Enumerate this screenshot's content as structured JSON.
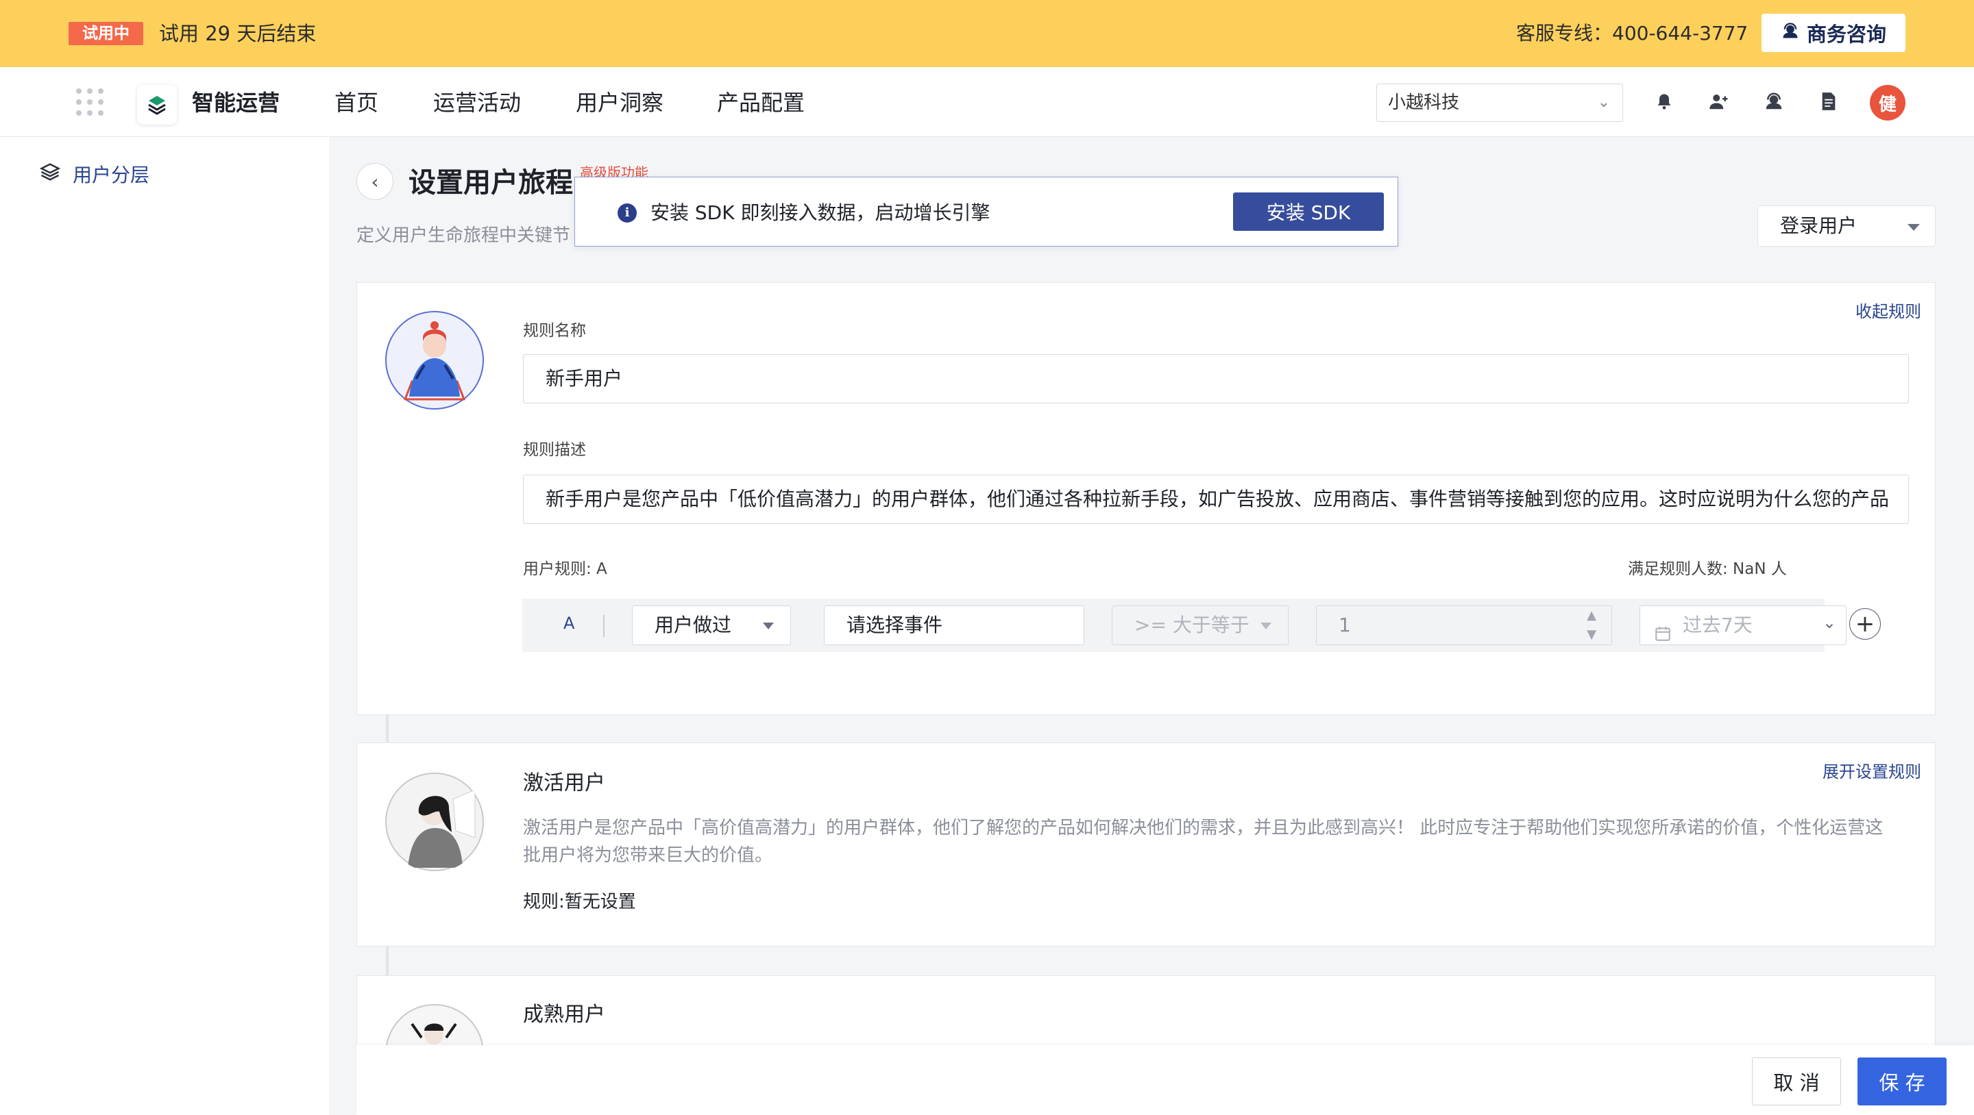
{
  "trial": {
    "badge": "试用中",
    "text": "试用 29 天后结束",
    "hotline": "客服专线：400-644-3777",
    "biz_button": "商务咨询"
  },
  "nav": {
    "app_title": "智能运营",
    "items": [
      "首页",
      "运营活动",
      "用户洞察",
      "产品配置"
    ],
    "company": "小越科技",
    "avatar_initial": "健"
  },
  "sidebar": {
    "items": [
      {
        "label": "用户分层",
        "icon": "layers-icon"
      }
    ]
  },
  "page": {
    "title": "设置用户旅程",
    "advanced_badge": "高级版功能",
    "description": "定义用户生命旅程中关键节",
    "user_select": "登录用户"
  },
  "sdk_banner": {
    "message": "安装 SDK 即刻接入数据，启动增长引擎",
    "button": "安装 SDK"
  },
  "rule_card": {
    "collapse_link": "收起规则",
    "name_label": "规则名称",
    "name_value": "新手用户",
    "desc_label": "规则描述",
    "desc_value": "新手用户是您产品中「低价值高潜力」的用户群体，他们通过各种拉新手段，如广告投放、应用商店、事件营销等接触到您的应用。这时应说明为什么您的产品",
    "user_rule_label": "用户规则: A",
    "match_count": "满足规则人数:  NaN 人",
    "row": {
      "letter": "A",
      "action": "用户做过",
      "event_placeholder": "请选择事件",
      "operator": ">= 大于等于",
      "value": "1",
      "time_range": "过去7天"
    }
  },
  "stages": [
    {
      "title": "激活用户",
      "expand_link": "展开设置规则",
      "description": "激活用户是您产品中「高价值高潜力」的用户群体，他们了解您的产品如何解决他们的需求，并且为此感到高兴！ 此时应专注于帮助他们实现您所承诺的价值，个性化运营这批用户将为您带来巨大的价值。",
      "rule": "规则:暂无设置"
    },
    {
      "title": "成熟用户"
    }
  ],
  "footer": {
    "cancel": "取 消",
    "save": "保 存"
  },
  "colors": {
    "trial_bar": "#fdd05c",
    "accent_navy": "#364c9c",
    "primary_blue": "#3464e0",
    "badge_red": "#f4694a"
  }
}
